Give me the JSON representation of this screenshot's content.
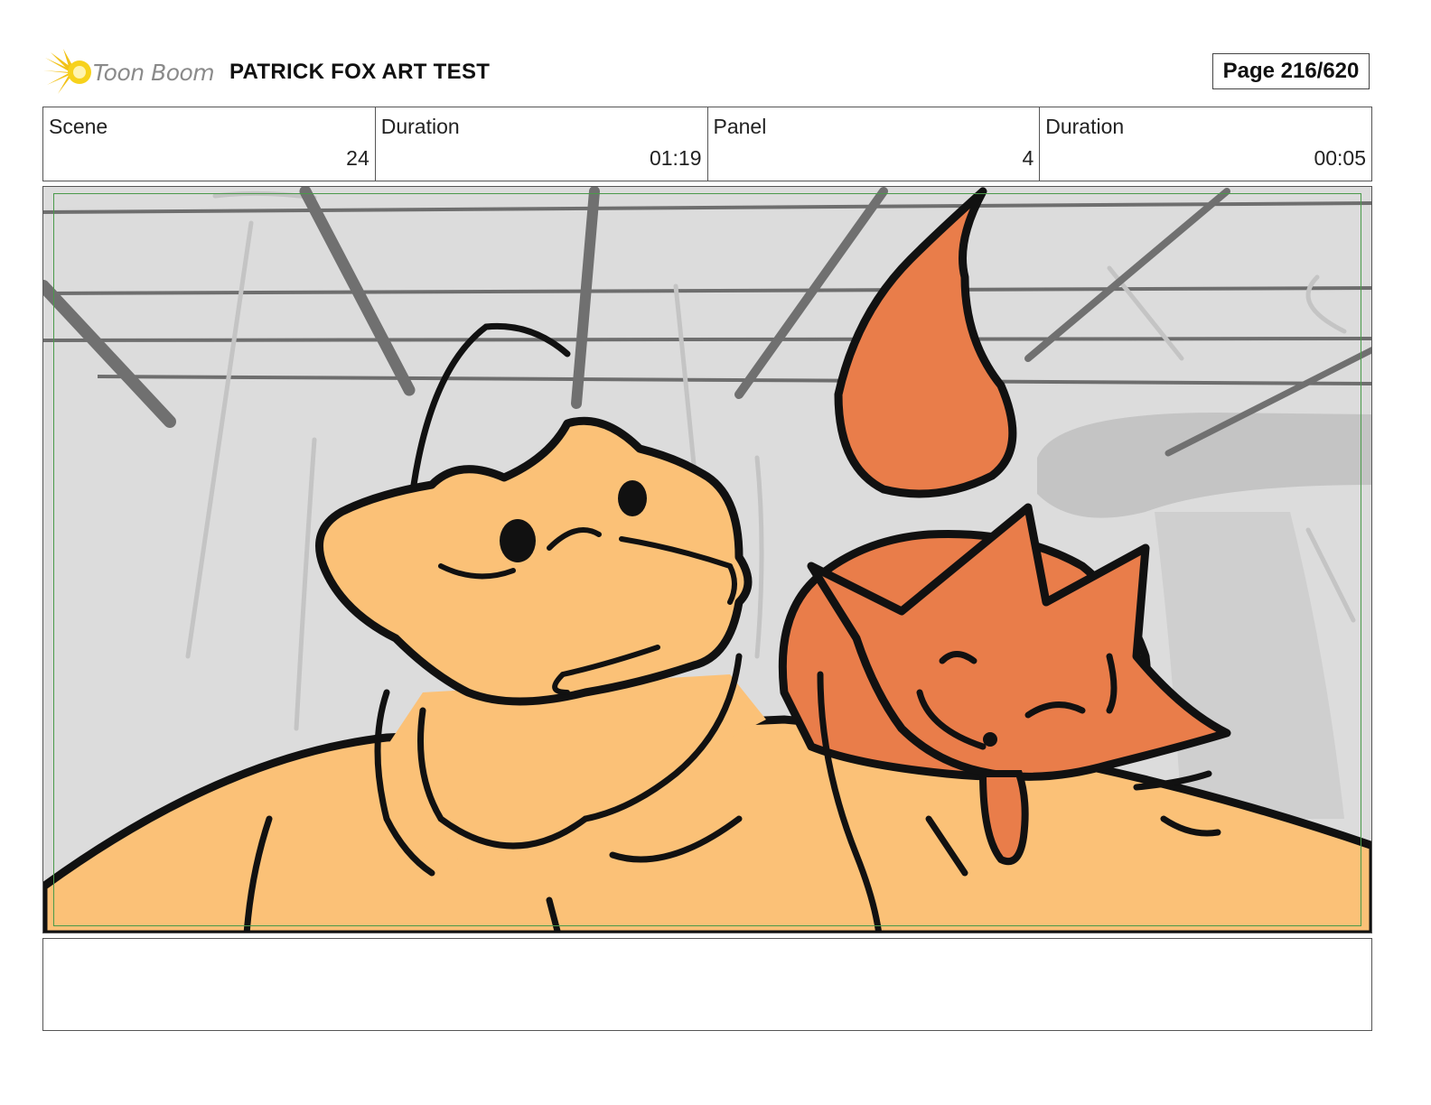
{
  "header": {
    "logo_text": "Toon Boom",
    "project_title": "PATRICK FOX ART TEST",
    "page_label": "Page 216/620"
  },
  "info": [
    {
      "label": "Scene",
      "value": "24"
    },
    {
      "label": "Duration",
      "value": "01:19"
    },
    {
      "label": "Panel",
      "value": "4"
    },
    {
      "label": "Duration",
      "value": "00:05"
    }
  ],
  "panel": {
    "colors": {
      "background": "#dcdcdc",
      "frog_skin": "#fbc177",
      "fox_orange": "#e97d4a",
      "line": "#111111",
      "safe_frame": "#4a9a4a"
    }
  },
  "notes": {
    "text": ""
  }
}
